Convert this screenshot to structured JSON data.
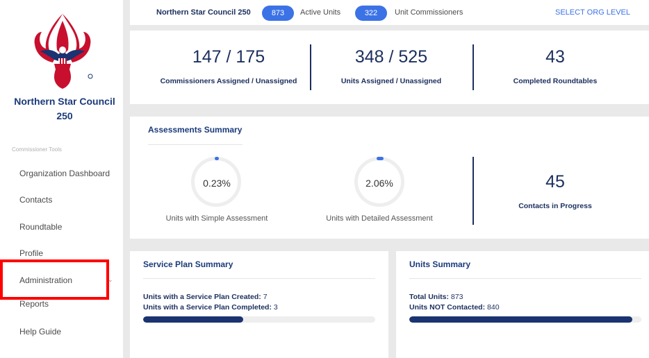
{
  "sidebar": {
    "council_name": "Northern Star Council 250",
    "tools_label": "Commissioner Tools",
    "items": [
      {
        "label": "Organization Dashboard"
      },
      {
        "label": "Contacts"
      },
      {
        "label": "Roundtable"
      },
      {
        "label": "Profile"
      },
      {
        "label": "Administration"
      },
      {
        "label": "Reports"
      },
      {
        "label": "Help Guide"
      }
    ]
  },
  "topbar": {
    "org_name": "Northern Star Council 250",
    "active_units_count": "873",
    "active_units_label": "Active Units",
    "unit_commissioners_count": "322",
    "unit_commissioners_label": "Unit Commissioners",
    "select_org": "SELECT ORG LEVEL"
  },
  "summary": {
    "commissioners_value": "147 / 175",
    "commissioners_label": "Commissioners Assigned / Unassigned",
    "units_value": "348 / 525",
    "units_label": "Units Assigned / Unassigned",
    "roundtables_value": "43",
    "roundtables_label": "Completed Roundtables"
  },
  "assessments": {
    "title": "Assessments Summary",
    "simple_value": "0.23%",
    "simple_fraction": 0.0023,
    "simple_label": "Units with Simple Assessment",
    "detailed_value": "2.06%",
    "detailed_fraction": 0.0206,
    "detailed_label": "Units with Detailed Assessment",
    "contacts_value": "45",
    "contacts_label": "Contacts in Progress"
  },
  "service_plan": {
    "title": "Service Plan Summary",
    "created_label": "Units with a Service Plan Created:",
    "created_value": "7",
    "completed_label": "Units with a Service Plan Completed:",
    "completed_value": "3",
    "progress_fraction": 0.43
  },
  "units_summary": {
    "title": "Units Summary",
    "total_label": "Total Units:",
    "total_value": "873",
    "not_contacted_label": "Units NOT Contacted:",
    "not_contacted_value": "840",
    "progress_fraction": 0.962
  },
  "colors": {
    "accent": "#3b72e6",
    "navy": "#1b2f5e",
    "logo_red": "#c8102e",
    "highlight": "#ff0000"
  }
}
